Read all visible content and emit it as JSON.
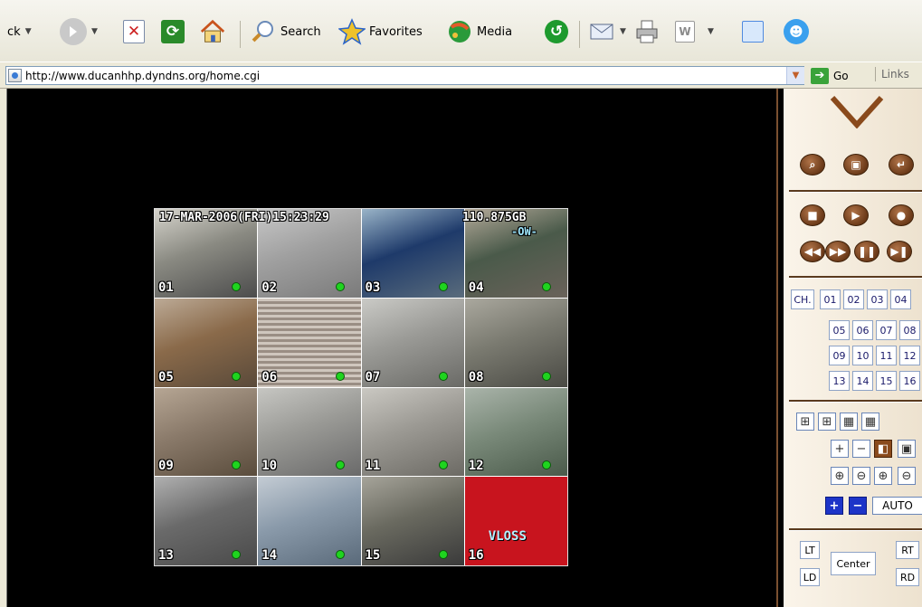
{
  "toolbar": {
    "back_label": "ck",
    "search_label": "Search",
    "favorites_label": "Favorites",
    "media_label": "Media"
  },
  "address_bar": {
    "url": "http://www.ducanhhp.dyndns.org/home.cgi",
    "go_label": "Go",
    "links_label": "Links"
  },
  "dvr": {
    "osd_date": "17-MAR-2006(FRI)15:23:29",
    "osd_storage": "110.875GB",
    "osd_mode": "-OW-",
    "vloss_label": "VLOSS",
    "cameras": [
      "01",
      "02",
      "03",
      "04",
      "05",
      "06",
      "07",
      "08",
      "09",
      "10",
      "11",
      "12",
      "13",
      "14",
      "15",
      "16"
    ]
  },
  "panel": {
    "ch_label": "CH.",
    "channels": [
      "01",
      "02",
      "03",
      "04",
      "05",
      "06",
      "07",
      "08",
      "09",
      "10",
      "11",
      "12",
      "13",
      "14",
      "15",
      "16"
    ],
    "auto_label": "AUTO",
    "ptz": {
      "lt": "LT",
      "ld": "LD",
      "center": "Center",
      "rt": "RT",
      "rd": "RD"
    }
  },
  "colors": {
    "panel_brown": "#6b3a19",
    "video_bg": "#000000",
    "vloss_red": "#c8141e",
    "status_green": "#1fd41f"
  },
  "icons": [
    "back-icon",
    "forward-icon",
    "stop-icon",
    "refresh-icon",
    "home-icon",
    "search-icon",
    "favorites-icon",
    "media-icon",
    "history-icon",
    "mail-icon",
    "print-icon",
    "edit-icon",
    "discuss-icon",
    "messenger-icon"
  ]
}
